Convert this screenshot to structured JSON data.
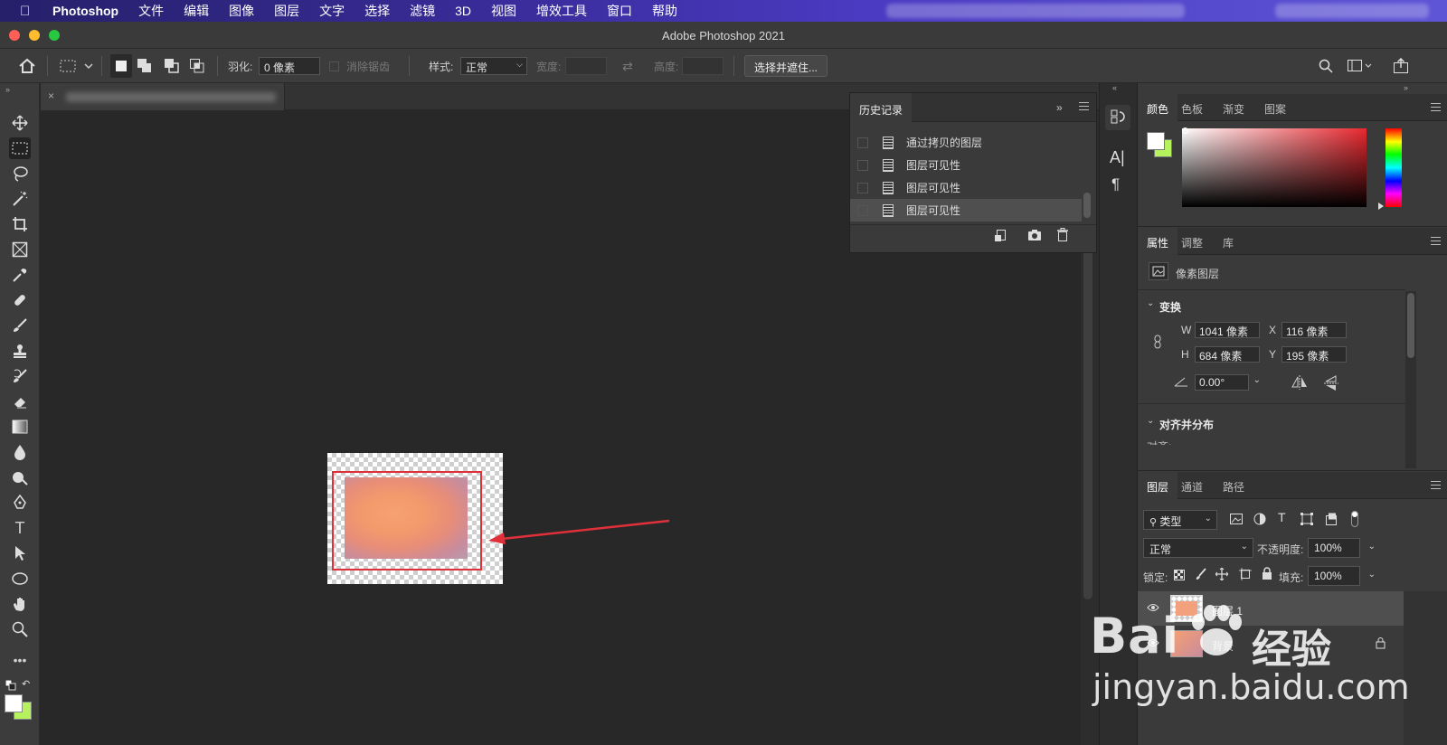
{
  "menubar": {
    "app_name": "Photoshop",
    "items": [
      "文件",
      "编辑",
      "图像",
      "图层",
      "文字",
      "选择",
      "滤镜",
      "3D",
      "视图",
      "增效工具",
      "窗口",
      "帮助"
    ]
  },
  "window": {
    "title": "Adobe Photoshop 2021"
  },
  "options_bar": {
    "feather_label": "羽化:",
    "feather_value": "0 像素",
    "antialias_label": "消除锯齿",
    "style_label": "样式:",
    "style_value": "正常",
    "width_label": "宽度:",
    "height_label": "高度:",
    "select_mask_button": "选择并遮住..."
  },
  "history": {
    "tab": "历史记录",
    "items": [
      "通过拷贝的图层",
      "图层可见性",
      "图层可见性",
      "图层可见性"
    ]
  },
  "color_panel": {
    "tabs": [
      "颜色",
      "色板",
      "渐变",
      "图案"
    ],
    "accent_hue": "#e8282f"
  },
  "properties": {
    "tabs": [
      "属性",
      "调整",
      "库"
    ],
    "layer_type": "像素图层",
    "transform_title": "变换",
    "w_label": "W",
    "w_value": "1041 像素",
    "x_label": "X",
    "x_value": "116 像素",
    "h_label": "H",
    "h_value": "684 像素",
    "y_label": "Y",
    "y_value": "195 像素",
    "angle_value": "0.00°",
    "align_title": "对齐并分布",
    "align_sub": "对齐:"
  },
  "layers": {
    "tabs": [
      "图层",
      "通道",
      "路径"
    ],
    "filter_kind": "类型",
    "blend_mode": "正常",
    "opacity_label": "不透明度:",
    "opacity_value": "100%",
    "lock_label": "锁定:",
    "fill_label": "填充:",
    "fill_value": "100%",
    "layer_names": [
      "图层 1",
      "背景"
    ]
  },
  "watermark": {
    "brand": "Bai",
    "brand2": "经验",
    "url": "jingyan.baidu.com"
  }
}
